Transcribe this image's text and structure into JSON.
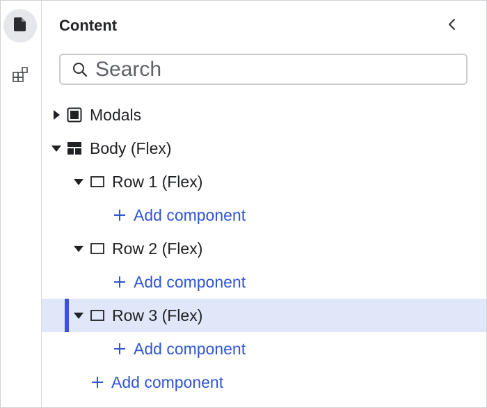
{
  "rail": {
    "items": [
      {
        "icon": "document-icon",
        "active": true
      },
      {
        "icon": "components-icon",
        "active": false
      }
    ]
  },
  "panel": {
    "title": "Content"
  },
  "search": {
    "placeholder": "Search",
    "value": ""
  },
  "tree": {
    "modals": {
      "label": "Modals",
      "expanded": false
    },
    "body": {
      "label": "Body (Flex)",
      "expanded": true
    },
    "rows": [
      {
        "label": "Row 1 (Flex)",
        "expanded": true,
        "selected": false,
        "add_label": "Add component"
      },
      {
        "label": "Row 2 (Flex)",
        "expanded": true,
        "selected": false,
        "add_label": "Add component"
      },
      {
        "label": "Row 3 (Flex)",
        "expanded": true,
        "selected": true,
        "add_label": "Add component"
      }
    ],
    "body_add_label": "Add component"
  },
  "colors": {
    "accent": "#2f55d4",
    "selection_bg": "#dfe7f8",
    "selection_bar": "#3f4fe6"
  }
}
